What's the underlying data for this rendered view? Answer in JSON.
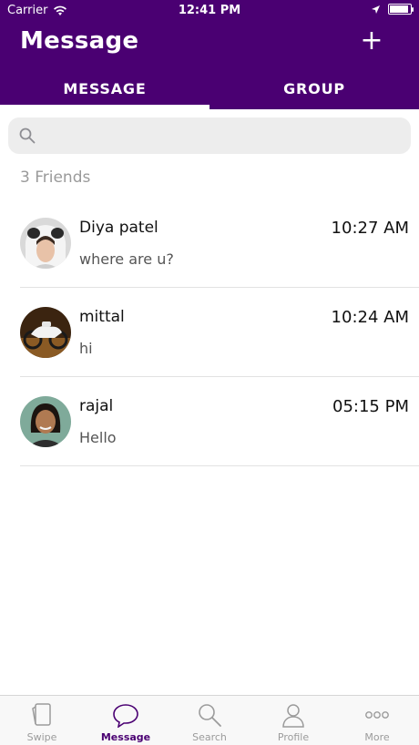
{
  "status_bar": {
    "carrier": "Carrier",
    "time": "12:41 PM"
  },
  "header": {
    "title": "Message",
    "add_label": "+"
  },
  "tabs": [
    {
      "label": "MESSAGE",
      "active": true
    },
    {
      "label": "GROUP",
      "active": false
    }
  ],
  "search": {
    "placeholder": "",
    "value": ""
  },
  "friends_count": "3 Friends",
  "conversations": [
    {
      "name": "Diya patel",
      "message": "where are u?",
      "time": "10:27 AM",
      "avatar_icon": "avatar-photo-diya"
    },
    {
      "name": "mittal",
      "message": "hi",
      "time": "10:24 AM",
      "avatar_icon": "avatar-photo-mittal"
    },
    {
      "name": "rajal",
      "message": "Hello",
      "time": "05:15 PM",
      "avatar_icon": "avatar-photo-rajal"
    }
  ],
  "tab_bar": [
    {
      "label": "Swipe",
      "icon": "swipe-cards-icon",
      "active": false
    },
    {
      "label": "Message",
      "icon": "chat-bubble-icon",
      "active": true
    },
    {
      "label": "Search",
      "icon": "search-icon",
      "active": false
    },
    {
      "label": "Profile",
      "icon": "profile-icon",
      "active": false
    },
    {
      "label": "More",
      "icon": "more-dots-icon",
      "active": false
    }
  ],
  "colors": {
    "brand": "#4a0072",
    "active_tab_indicator": "#ffffff",
    "search_background": "#ededed",
    "muted_text": "#9a9a9a"
  }
}
